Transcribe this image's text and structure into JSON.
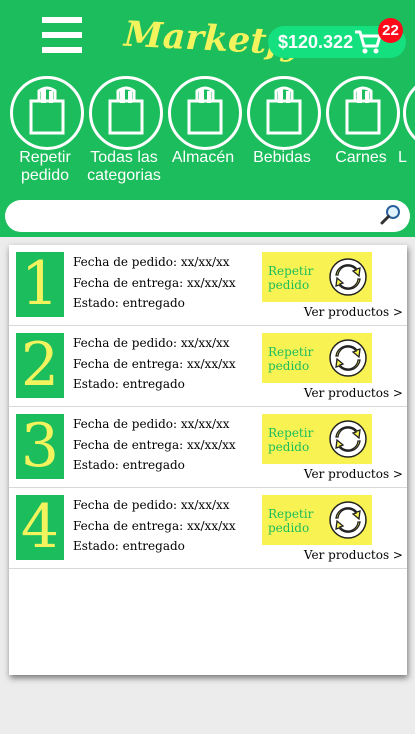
{
  "header": {
    "logo_text": "Marketfy",
    "cart_amount": "$120.322",
    "cart_count": "22",
    "menu_icon": "hamburger-menu-icon",
    "cart_icon": "shopping-cart-icon"
  },
  "categories": [
    {
      "label": "Repetir pedido",
      "icon": "grocery-bag-icon"
    },
    {
      "label": "Todas las categorias",
      "icon": "grocery-bag-icon"
    },
    {
      "label": "Almacén",
      "icon": "grocery-bag-icon"
    },
    {
      "label": "Bebidas",
      "icon": "grocery-bag-icon"
    },
    {
      "label": "Carnes",
      "icon": "grocery-bag-icon"
    },
    {
      "label": "L",
      "icon": "grocery-bag-icon"
    }
  ],
  "search": {
    "placeholder": "",
    "icon": "magnifier-icon"
  },
  "orders": [
    {
      "number": "1",
      "order_date": "Fecha de pedido: xx/xx/xx",
      "delivery_date": "Fecha de entrega: xx/xx/xx",
      "status": "Estado: entregado",
      "repeat_label": "Repetir pedido",
      "view_label": "Ver productos >"
    },
    {
      "number": "2",
      "order_date": "Fecha de pedido: xx/xx/xx",
      "delivery_date": "Fecha de entrega: xx/xx/xx",
      "status": "Estado: entregado",
      "repeat_label": "Repetir pedido",
      "view_label": "Ver productos >"
    },
    {
      "number": "3",
      "order_date": "Fecha de pedido: xx/xx/xx",
      "delivery_date": "Fecha de entrega: xx/xx/xx",
      "status": "Estado: entregado",
      "repeat_label": "Repetir pedido",
      "view_label": "Ver productos >"
    },
    {
      "number": "4",
      "order_date": "Fecha de pedido: xx/xx/xx",
      "delivery_date": "Fecha de entrega: xx/xx/xx",
      "status": "Estado: entregado",
      "repeat_label": "Repetir pedido",
      "view_label": "Ver productos >"
    }
  ],
  "colors": {
    "brand_green": "#1cbd5c",
    "accent_yellow": "#f8f353",
    "logo_yellow": "#f3f35e",
    "badge_red": "#ff0a1a",
    "pill_green": "#14e07f"
  }
}
